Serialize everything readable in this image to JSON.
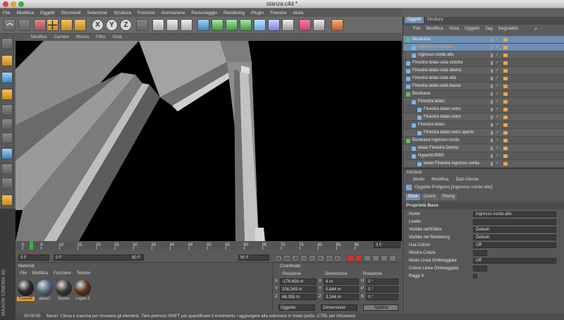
{
  "window": {
    "title": "stanza.c4d *"
  },
  "menubar": [
    "File",
    "Modifica",
    "Oggetti",
    "Strumenti",
    "Selezione",
    "Struttura",
    "Funzioni",
    "Animazione",
    "Personaggio",
    "Rendering",
    "Plugin",
    "Finestre",
    "Aiuto"
  ],
  "viewport": {
    "menu": [
      "Modifica",
      "Camere",
      "Mostra",
      "Filtro",
      "Vista"
    ]
  },
  "timeline": {
    "ticks": [
      "0",
      "5",
      "10",
      "15",
      "20",
      "25",
      "30",
      "35",
      "40",
      "45",
      "50",
      "55",
      "60",
      "65",
      "70",
      "75",
      "80",
      "85",
      "90"
    ],
    "frame_right": "3 F",
    "start": "0 F",
    "current": "0 F",
    "end": "90 F",
    "end2": "90 F"
  },
  "materials": {
    "title": "Materiali",
    "menu": [
      "File",
      "Modifica",
      "Funzione",
      "Texture"
    ],
    "items": [
      "Cassetti",
      "glass1",
      "Nuovo",
      "Legno 2"
    ]
  },
  "coords": {
    "title": "Coordinate",
    "headers": [
      "Posizione",
      "Dimensione",
      "Rotazione"
    ],
    "rows": [
      {
        "axis": "X",
        "pos": "-176.656 m",
        "daxis": "X",
        "dim": "6 m",
        "raxis": "H",
        "rot": "0 °"
      },
      {
        "axis": "Y",
        "pos": "208.269 m",
        "daxis": "Y",
        "dim": "0.844 m",
        "raxis": "P",
        "rot": "0 °"
      },
      {
        "axis": "Z",
        "pos": "66.355 m",
        "daxis": "Z",
        "dim": "3.244 m",
        "raxis": "B",
        "rot": "0 °"
      }
    ],
    "mode1": "Oggetto",
    "mode2": "Dimensione",
    "apply": "Applica"
  },
  "status": {
    "time": "00:00:00",
    "text": "Muovi: Clicca e trascina per muovere gli elementi. Tieni premuto SHIFT per quantificare il movimento / aggiungere alla selezione in modo punto, CTRL per rimuovere."
  },
  "objects": {
    "tabs": [
      "Oggetti",
      "Struttura"
    ],
    "menu": [
      "File",
      "Modifica",
      "Vista",
      "Oggetti",
      "Tag",
      "Segnalibri"
    ],
    "rows": [
      {
        "label": "Booleana",
        "level": 0,
        "selected": true
      },
      {
        "label": "ingresso corda alto",
        "level": 1,
        "selected": true,
        "orange": true
      },
      {
        "label": "ingresso corda alto",
        "level": 1
      },
      {
        "label": "Finestra telaio asta sinistra",
        "level": 0
      },
      {
        "label": "Finestra telaio asta destra",
        "level": 0
      },
      {
        "label": "Finestra telaio asta alta",
        "level": 0
      },
      {
        "label": "Finestra telaio asta bassa",
        "level": 0
      },
      {
        "label": "Booleana",
        "level": 0
      },
      {
        "label": "Finestra telaio",
        "level": 1
      },
      {
        "label": "Finestra telaio vetro",
        "level": 2
      },
      {
        "label": "Finestra telaio vetro",
        "level": 2
      },
      {
        "label": "Finestra telaio",
        "level": 1
      },
      {
        "label": "Finestra telaio vetro aperto",
        "level": 2
      },
      {
        "label": "Booleana ingresso corda",
        "level": 0
      },
      {
        "label": "telaio Finestra Destra",
        "level": 1
      },
      {
        "label": "HyperNURBS",
        "level": 1
      },
      {
        "label": "telaio Finestra ingresso corda",
        "level": 2
      }
    ]
  },
  "attributes": {
    "title": "Attributi",
    "menu": [
      "Modo",
      "Modifica",
      "Dati Utente"
    ],
    "object_title": "Oggetto Poligono [ingresso corda alto]",
    "tabs": [
      "Base",
      "Coord.",
      "Phong"
    ],
    "section": "Proprietà Base",
    "rows": [
      {
        "label": "Nome",
        "value": "ingresso corda alto"
      },
      {
        "label": "Livello",
        "value": ""
      },
      {
        "label": "Visibile nell'Editor",
        "value": "Default"
      },
      {
        "label": "Visibile nel Rendering",
        "value": "Default"
      },
      {
        "label": "Usa Colore",
        "value": "Off"
      },
      {
        "label": "Mostra Colore",
        "value": ""
      },
      {
        "label": "Modo Linea Ombreggiata",
        "value": "Off"
      },
      {
        "label": "Colore Linea Ombreggiata",
        "value": ""
      },
      {
        "label": "Raggi X",
        "value": ""
      }
    ]
  },
  "brand": "MAXON CINEMA 4D",
  "colors": {
    "accent": "#f0a23a",
    "select": "#6f8fb5",
    "viewport": "#000000"
  }
}
